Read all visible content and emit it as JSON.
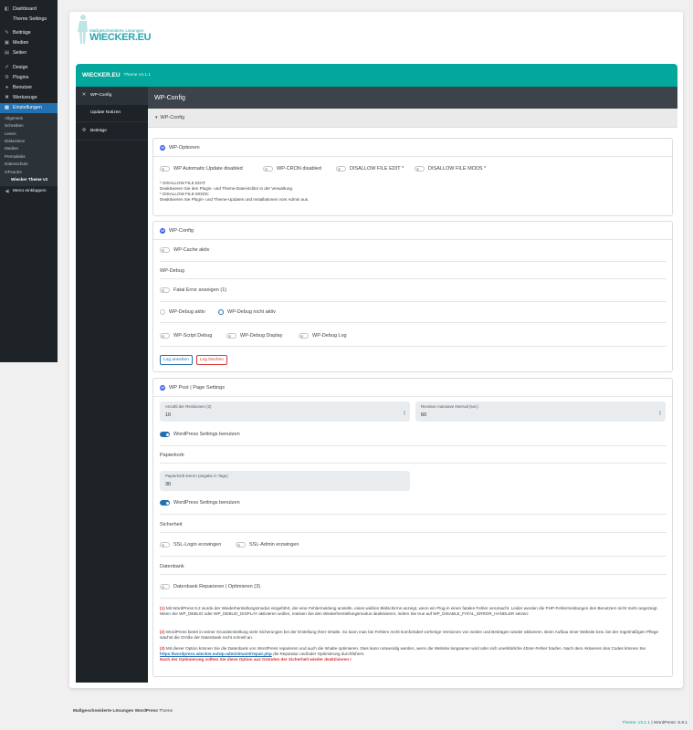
{
  "admin_menu": {
    "items": [
      {
        "icon": "dashboard-icon",
        "glyph": "◧",
        "label": "Dashboard"
      },
      {
        "icon": "",
        "glyph": "",
        "label": "Theme Settings",
        "sub": true
      },
      {
        "icon": "pin-icon",
        "glyph": "✎",
        "label": "Beiträge"
      },
      {
        "icon": "media-icon",
        "glyph": "▣",
        "label": "Medien"
      },
      {
        "icon": "page-icon",
        "glyph": "▤",
        "label": "Seiten"
      },
      {
        "icon": "brush-icon",
        "glyph": "✐",
        "label": "Design"
      },
      {
        "icon": "plugin-icon",
        "glyph": "⚙",
        "label": "Plugins"
      },
      {
        "icon": "user-icon",
        "glyph": "●",
        "label": "Benutzer"
      },
      {
        "icon": "wrench-icon",
        "glyph": "✖",
        "label": "Werkzeuge"
      },
      {
        "icon": "settings-icon",
        "glyph": "▦",
        "label": "Einstellungen",
        "active": true
      }
    ],
    "submenu": [
      "Allgemein",
      "Schreiben",
      "Lesen",
      "Diskussion",
      "Medien",
      "Permalinks",
      "Datenschutz",
      "OPcache"
    ],
    "submenu_current": "Wiecker Theme v3",
    "collapse_label": "Menü einklappen"
  },
  "logo": {
    "tagline": "Maßgeschneiderte Lösungen",
    "brand": "WIECKER.EU"
  },
  "header": {
    "title": "WIECKER.EU",
    "version": "Theme v3.1.1"
  },
  "sidenav": [
    {
      "icon": "tools-icon",
      "glyph": "✕",
      "label": "WP-Config",
      "active": true
    },
    {
      "icon": "notes-icon",
      "glyph": "",
      "label": "Update Notizen"
    },
    {
      "icon": "posts-icon",
      "glyph": "✣",
      "label": "Beiträge"
    }
  ],
  "main": {
    "title": "WP-Config",
    "breadcrumb": "WP-Config",
    "breadcrumb_glyph": "▾"
  },
  "wp_options": {
    "title": "WP-Optionen",
    "toggles": [
      "WP Automatic Update disabled",
      "WP-CRON disabled",
      "DISALLOW FILE EDIT *",
      "DISALLOW FILE MODS *"
    ],
    "note1_title": "* DISALLOW FILE EDIT:",
    "note1_text": "Deaktivieren Sie den Plugin- und Theme-Datei-Editor in der Verwaltung.",
    "note2_title": "* DISALLOW FILE MODS:",
    "note2_text": "Deaktivieren Sie Plugin- und Theme-Updates und Installationen vom Admin aus."
  },
  "wp_config": {
    "title": "WP-Config",
    "cache_toggle": "WP-Cache aktiv",
    "debug_section": "WP-Debug",
    "fatal_toggle": "Fatal Error anzeigen (1)",
    "radio_active": "WP-Debug aktiv",
    "radio_inactive": "WP-Debug nicht aktiv",
    "debug_toggles": [
      "WP-Script Debug",
      "WP-Debug Display",
      "WP-Debug Log"
    ],
    "btn_view_log": "Log ansehen",
    "btn_delete_log": "Log löschen"
  },
  "post_settings": {
    "title": "WP Post | Page Settings",
    "revisions_label": "Anzahl der Revisionen (2)",
    "revisions_value": "10",
    "autosave_label": "Revision Autosave Interval (sec)",
    "autosave_value": "60",
    "use_wp_settings": "WordPress Settings benutzen",
    "trash_section": "Papierkorb",
    "trash_label": "Papierkorb leeren (angabe in Tage)",
    "trash_value": "30",
    "use_wp_settings2": "WordPress Settings benutzen",
    "security_section": "Sicherheit",
    "ssl_login": "SSL-Login erzwingen",
    "ssl_admin": "SSL-Admin erzwingen",
    "db_section": "Datenbank",
    "db_toggle": "Datenbank Reparieren | Optimieren (3)"
  },
  "footnotes": {
    "n1": "(1)",
    "t1": "Mit WordPress 5.2 wurde der Wiederherstellungsmodus eingeführt, der eine Fehlermeldung anstelle, eines weißen Bildschirms anzeigt, wenn ein Plug-in einen fatalen Fehler verursacht. Leider werden die PHP-Fehlermeldungen den Benutzern nicht mehr angezeigt. Wenn Sie WP_DEBUG oder WP_DEBUG_DISPLAY aktivieren wollen, müssen Sie den Wiederherstellungsmodus deaktivieren, indem Sie true auf WP_DISABLE_FATAL_ERROR_HANDLER setzen:",
    "n2": "(2)",
    "t2": "WordPress bietet in seiner Grundeinstellung viele Sicherungen bei der Erstellung Ihrer Inhalte. So kann man bei Fehlern recht komfortabel vorherige Versionen von Seiten und Beiträgen wieder aktivieren. Beim Aufbau einer Website bzw. bei der regelmäßigen Pflege wächst die Größe der Datenbank recht schnell an.",
    "n3": "(3)",
    "t3a": "Mit dieser Option können Sie die Datenbank von WordPress reparieren und auch die Inhalte optimieren. Dies kann notwendig werden, wenn die Website langsamer wird oder sich unerklärliche 404er-Fehler häufen. Nach dem Aktivieren des Codes können Sie",
    "t3link": "https://wordpress.wiecker.eu/wp-admin/maint/repair.php",
    "t3b": "die Reparatur und/oder Optimierung durchführen.",
    "t3warn": "Nach der Optimierung sollten Sie diese Option aus Gründen der Sicherheit wieder deaktivieren !"
  },
  "footer": {
    "left_bold": "Maßgeschneiderte Lösungen",
    "left_brand": "WordPress",
    "left_rest": "Theme",
    "right_theme": "Theme: v3.1.1",
    "right_sep": "|",
    "right_wp": "WordPress: 6.8.1"
  }
}
